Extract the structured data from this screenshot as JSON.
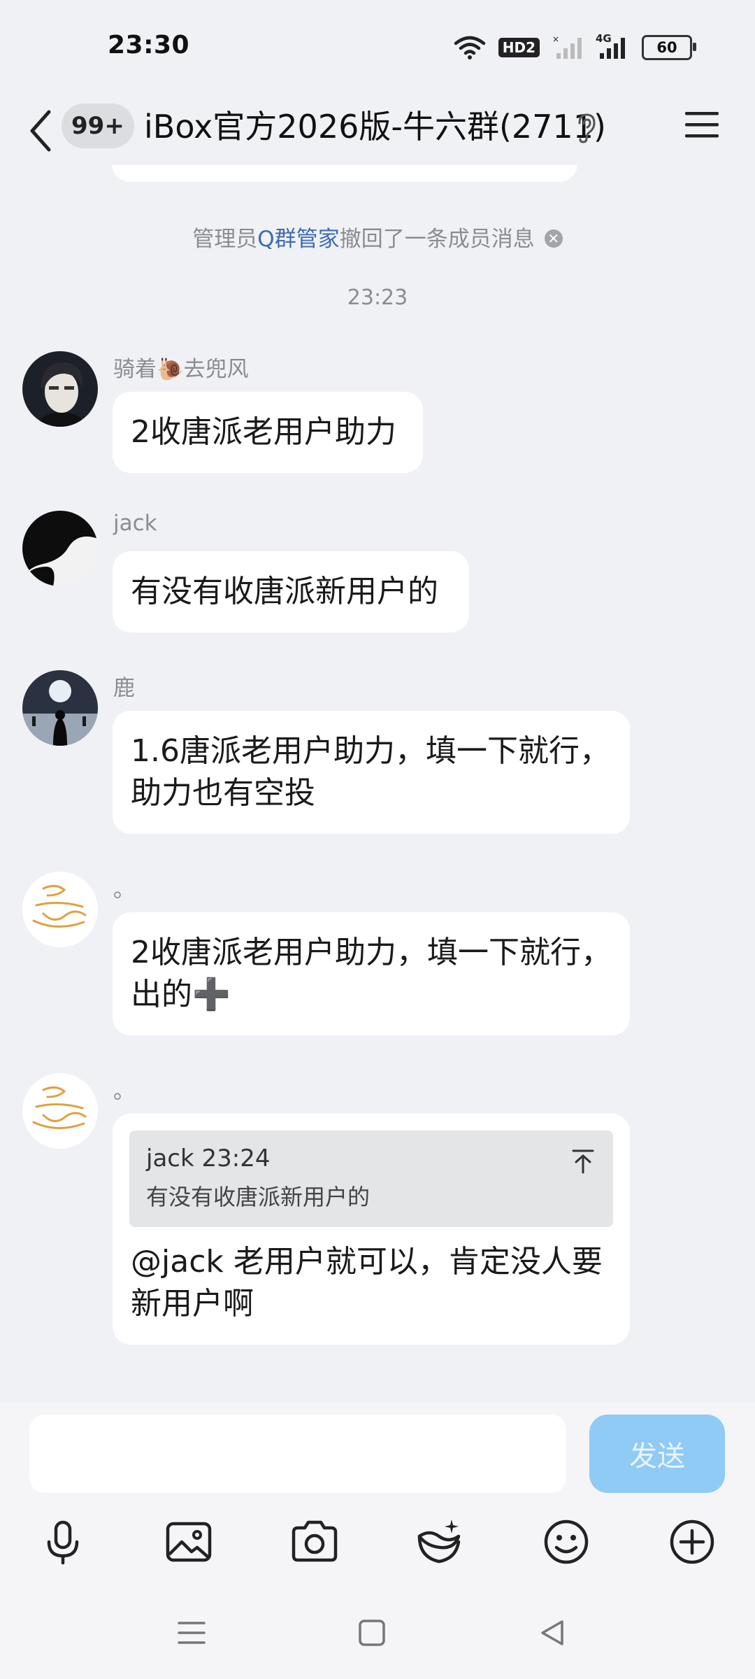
{
  "status_bar": {
    "time": "23:30",
    "hd_label": "HD2",
    "network_label": "4G",
    "battery": "60"
  },
  "header": {
    "unread_count": "99+",
    "title": "iBox官方2026版-牛六群(2711)"
  },
  "system_message": {
    "prefix": "管理员",
    "admin_name": "Q群管家",
    "suffix": "撤回了一条成员消息"
  },
  "timestamp": "23:23",
  "messages": [
    {
      "sender": "骑着🐌去兜风",
      "text": "2收唐派老用户助力"
    },
    {
      "sender": "jack",
      "text": "有没有收唐派新用户的"
    },
    {
      "sender": "鹿",
      "text": "1.6唐派老用户助力，填一下就行，助力也有空投"
    },
    {
      "sender": "。",
      "text": "2收唐派老用户助力，填一下就行，出的➕"
    },
    {
      "sender": "。",
      "quote_header": "jack 23:24",
      "quote_text": "有没有收唐派新用户的",
      "text": "@jack 老用户就可以，肯定没人要新用户啊"
    }
  ],
  "input": {
    "placeholder": "",
    "send_label": "发送"
  },
  "toolbar_icons": [
    "microphone-icon",
    "image-icon",
    "camera-icon",
    "sticker-icon",
    "emoji-icon",
    "plus-icon"
  ],
  "colors": {
    "background": "#f0f1f5",
    "bubble": "#ffffff",
    "link": "#3e6ab0",
    "send_button": "#8fcbf5",
    "meta_text": "#8a8c91"
  }
}
